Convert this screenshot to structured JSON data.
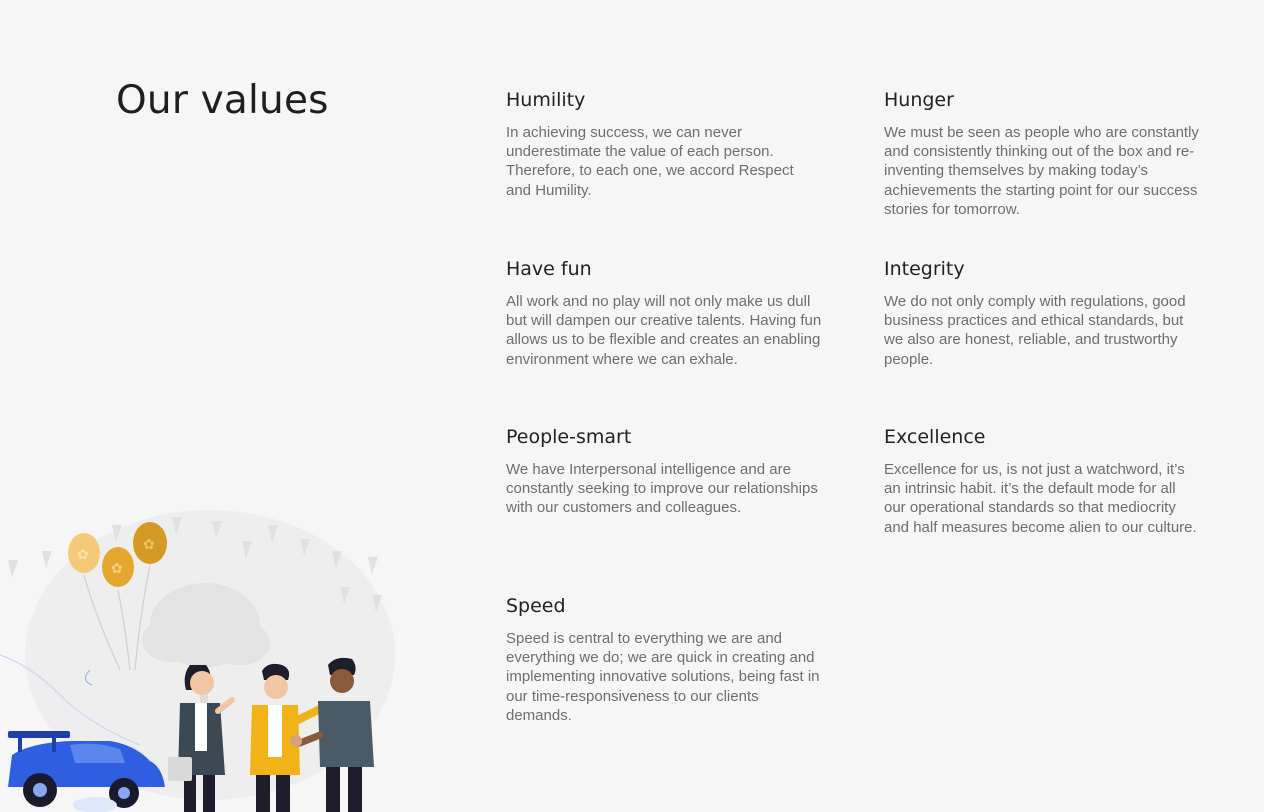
{
  "page": {
    "title": "Our values"
  },
  "values": [
    {
      "title": "Humility",
      "body": "In achieving success, we can never underestimate the value of each person. Therefore, to each one, we accord Respect and Humility."
    },
    {
      "title": "Hunger",
      "body": "We must be seen as people who are constantly and consistently thinking out of the box  and re-inventing themselves by making today’s achievements the starting point for our success  stories for tomorrow."
    },
    {
      "title": "Have fun",
      "body": "All work and no play will not only make us dull but will dampen our creative talents. Having fun allows us to be flexible and creates an enabling environment where we can exhale."
    },
    {
      "title": "Integrity",
      "body": "We do not only comply with regulations, good business practices and ethical standards,  but we also are honest, reliable, and trustworthy people."
    },
    {
      "title": "People-smart",
      "body": "We have Interpersonal intelligence and are constantly seeking to improve our relationships with our customers and colleagues."
    },
    {
      "title": "Excellence",
      "body": "Excellence for us, is not just a watchword, it’s an intrinsic habit. it’s the default mode for all our operational standards so that mediocrity and half measures become alien to our  culture."
    },
    {
      "title": "Speed",
      "body": "Speed is central to everything we are and everything we do; we are quick in creating and implementing innovative solutions, being fast in our time-responsiveness to our clients demands."
    }
  ],
  "colors": {
    "background": "#f6f6f6",
    "heading": "#222222",
    "body_text": "#6e6e6e",
    "car_blue": "#2f5fe0",
    "balloon_gold": "#d9a42c",
    "jacket_yellow": "#f2b319"
  },
  "illustration": {
    "subject": "team-celebration-illustration"
  }
}
